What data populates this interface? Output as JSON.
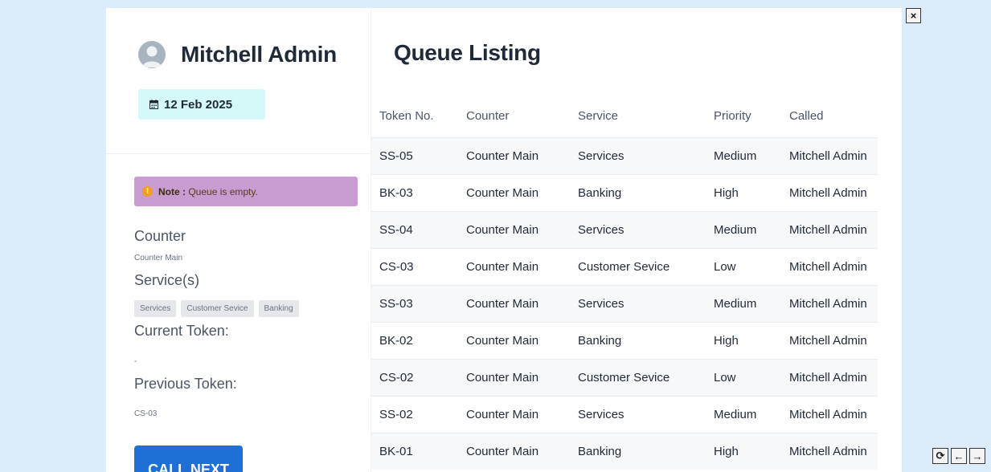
{
  "user": {
    "name": "Mitchell Admin",
    "date": "12 Feb 2025"
  },
  "note": {
    "label": "Note :",
    "text": "Queue is empty."
  },
  "counter_section": {
    "label": "Counter",
    "value": "Counter Main"
  },
  "services_section": {
    "label": "Service(s)",
    "chips": [
      "Services",
      "Customer Sevice",
      "Banking"
    ]
  },
  "current_token": {
    "label": "Current Token:",
    "value": "-"
  },
  "previous_token": {
    "label": "Previous Token:",
    "value": "CS-03"
  },
  "call_next_label": "CALL NEXT",
  "listing": {
    "title": "Queue Listing",
    "headers": [
      "Token No.",
      "Counter",
      "Service",
      "Priority",
      "Called"
    ],
    "rows": [
      [
        "SS-05",
        "Counter Main",
        "Services",
        "Medium",
        "Mitchell Admin"
      ],
      [
        "BK-03",
        "Counter Main",
        "Banking",
        "High",
        "Mitchell Admin"
      ],
      [
        "SS-04",
        "Counter Main",
        "Services",
        "Medium",
        "Mitchell Admin"
      ],
      [
        "CS-03",
        "Counter Main",
        "Customer Sevice",
        "Low",
        "Mitchell Admin"
      ],
      [
        "SS-03",
        "Counter Main",
        "Services",
        "Medium",
        "Mitchell Admin"
      ],
      [
        "BK-02",
        "Counter Main",
        "Banking",
        "High",
        "Mitchell Admin"
      ],
      [
        "CS-02",
        "Counter Main",
        "Customer Sevice",
        "Low",
        "Mitchell Admin"
      ],
      [
        "SS-02",
        "Counter Main",
        "Services",
        "Medium",
        "Mitchell Admin"
      ],
      [
        "BK-01",
        "Counter Main",
        "Banking",
        "High",
        "Mitchell Admin"
      ]
    ]
  },
  "window_controls": {
    "close": "×",
    "refresh": "⟳",
    "prev": "←",
    "next": "→"
  },
  "colors": {
    "background": "#dcecfb",
    "date_badge": "#d5f8f8",
    "note_bg": "#c89bd1",
    "primary_button": "#1e6fd6"
  },
  "icons": {
    "avatar": "user-avatar-icon",
    "date": "calendar-icon",
    "note": "warning-icon"
  }
}
